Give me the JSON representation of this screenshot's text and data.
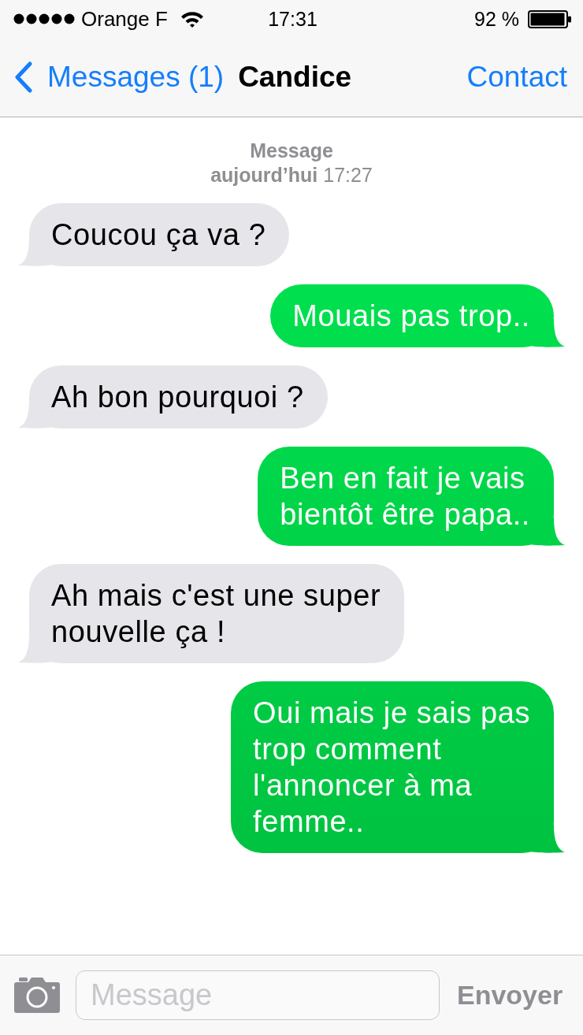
{
  "status_bar": {
    "carrier": "Orange F",
    "time": "17:31",
    "battery": "92 %"
  },
  "nav_bar": {
    "back_label": "Messages (1)",
    "title": "Candice",
    "action": "Contact"
  },
  "thread_header": {
    "title": "Message",
    "timestamp": "**aujourd’hui** 17:27"
  },
  "messages": [
    {
      "kind": "incoming",
      "lines": [
        "Coucou ça va ?"
      ]
    },
    {
      "kind": "outgoing",
      "lines": [
        "Mouais pas trop.."
      ]
    },
    {
      "kind": "incoming",
      "lines": [
        "Ah bon pourquoi ?"
      ]
    },
    {
      "kind": "outgoing",
      "lines": [
        "Ben en fait je vais",
        "bientôt être papa.."
      ]
    },
    {
      "kind": "incoming",
      "lines": [
        "Ah mais c'est une super",
        "nouvelle ça !"
      ]
    },
    {
      "kind": "outgoing",
      "lines": [
        "Oui mais je sais pas",
        "trop comment",
        "l'annoncer à ma",
        "femme.."
      ]
    }
  ],
  "composer": {
    "placeholder": "Message",
    "send_label": "Envoyer",
    "disabled": true
  }
}
